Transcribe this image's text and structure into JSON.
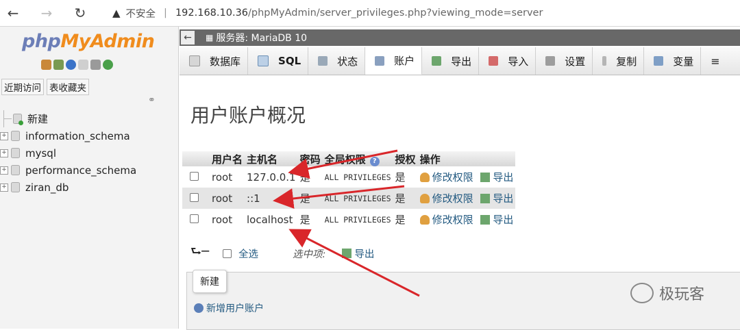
{
  "browser": {
    "insecure_label": "不安全",
    "url_host": "192.168.10.36",
    "url_path": "/phpMyAdmin/server_privileges.php?viewing_mode=server"
  },
  "logo": {
    "php": "php",
    "myadmin": "MyAdmin"
  },
  "nav_tabs": [
    "近期访问",
    "表收藏夹"
  ],
  "databases": [
    "新建",
    "information_schema",
    "mysql",
    "performance_schema",
    "ziran_db"
  ],
  "server_title": "服务器: MariaDB 10",
  "tabs": [
    {
      "label": "数据库",
      "icon": "database-icon"
    },
    {
      "label": "SQL",
      "icon": "sql-icon"
    },
    {
      "label": "状态",
      "icon": "status-icon"
    },
    {
      "label": "账户",
      "icon": "accounts-icon"
    },
    {
      "label": "导出",
      "icon": "export-icon"
    },
    {
      "label": "导入",
      "icon": "import-icon"
    },
    {
      "label": "设置",
      "icon": "settings-icon"
    },
    {
      "label": "复制",
      "icon": "replication-icon"
    },
    {
      "label": "变量",
      "icon": "variables-icon"
    },
    {
      "label": "",
      "icon": "more-icon"
    }
  ],
  "active_tab": "账户",
  "page_title": "用户账户概况",
  "table": {
    "headers": [
      "用户名",
      "主机名",
      "密码",
      "全局权限",
      "授权",
      "操作"
    ],
    "rows": [
      {
        "user": "root",
        "host": "127.0.0.1",
        "password": "是",
        "privileges": "ALL PRIVILEGES",
        "grant": "是",
        "edit": "修改权限",
        "export": "导出"
      },
      {
        "user": "root",
        "host": "::1",
        "password": "是",
        "privileges": "ALL PRIVILEGES",
        "grant": "是",
        "edit": "修改权限",
        "export": "导出"
      },
      {
        "user": "root",
        "host": "localhost",
        "password": "是",
        "privileges": "ALL PRIVILEGES",
        "grant": "是",
        "edit": "修改权限",
        "export": "导出"
      }
    ]
  },
  "bulk": {
    "select_all": "全选",
    "with_selected": "选中项:",
    "export": "导出"
  },
  "new_section": {
    "legend": "新建",
    "add_user": "新增用户账户"
  },
  "watermark": "极玩客",
  "colors": {
    "arrow": "#d9262a",
    "link": "#235a81",
    "logo_orange": "#f08c1d",
    "logo_blue": "#6c7eb7"
  }
}
